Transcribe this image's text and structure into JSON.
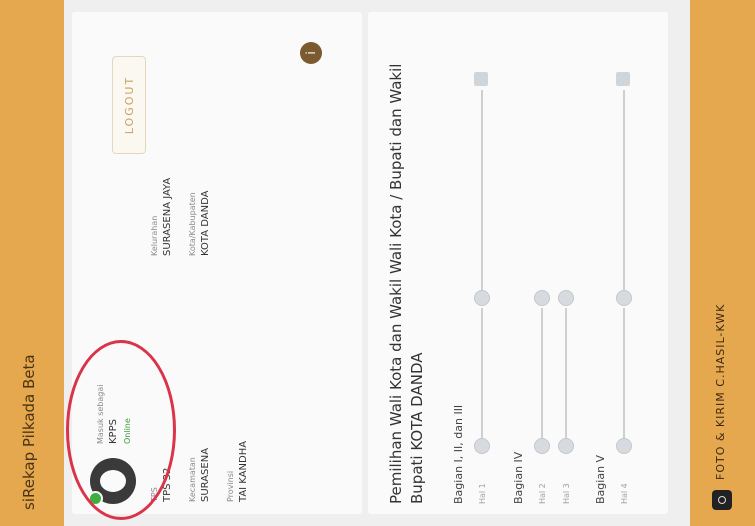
{
  "app": {
    "title": "siRekap Pilkada Beta"
  },
  "user": {
    "masuk_label": "Masuk sebagai",
    "role": "KPPS",
    "status": "Online",
    "logout_label": "LOGOUT"
  },
  "location": {
    "tps_label": "TPS",
    "tps_value": "TPS 32",
    "kelurahan_label": "Kelurahan",
    "kelurahan_value": "SURASENA JAYA",
    "kecamatan_label": "Kecamatan",
    "kecamatan_value": "SURASENA",
    "kota_label": "Kota/Kabupaten",
    "kota_value": "KOTA DANDA",
    "provinsi_label": "Provinsi",
    "provinsi_value": "TAI KANDHA"
  },
  "election": {
    "heading": "Pemilihan Wali Kota dan Wakil Wali Kota / Bupati dan Wakil Bupati KOTA DANDA",
    "parts": [
      {
        "label": "Bagian I, II, dan III",
        "hal": "Hal 1"
      },
      {
        "label": "Bagian IV",
        "hal_a": "Hal 2",
        "hal_b": "Hal 3"
      },
      {
        "label": "Bagian V",
        "hal": "Hal 4"
      }
    ]
  },
  "bottom_action": {
    "label": "FOTO & KIRIM C.HASIL-KWK"
  },
  "icons": {
    "info": "info-icon",
    "camera": "camera-icon",
    "check": "check-icon"
  },
  "colors": {
    "accent": "#e6a84f",
    "online": "#3fae3f",
    "annotation": "#d9344a"
  }
}
